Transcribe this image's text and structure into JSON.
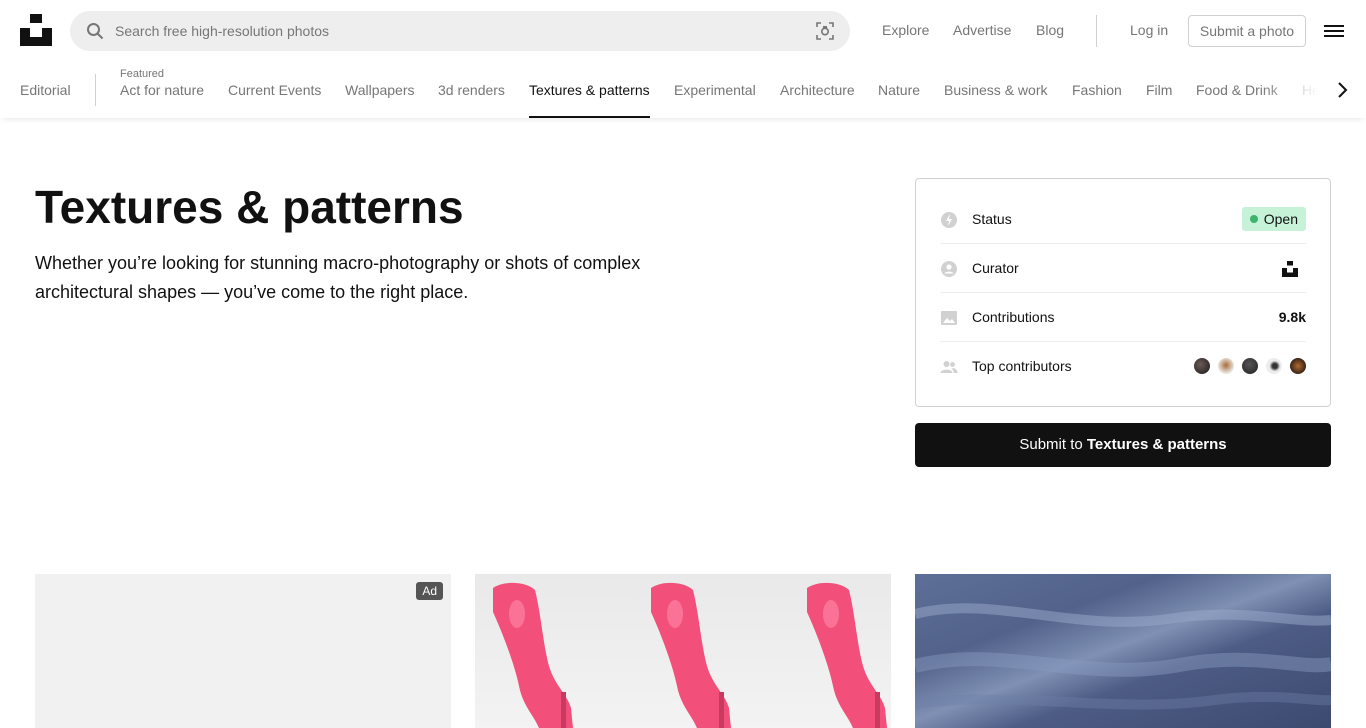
{
  "header": {
    "search_placeholder": "Search free high-resolution photos",
    "nav": {
      "explore": "Explore",
      "advertise": "Advertise",
      "blog": "Blog",
      "login": "Log in",
      "submit_photo": "Submit a photo"
    }
  },
  "topics": {
    "editorial": "Editorial",
    "featured_label": "Featured",
    "items": [
      "Act for nature",
      "Current Events",
      "Wallpapers",
      "3d renders",
      "Textures & patterns",
      "Experimental",
      "Architecture",
      "Nature",
      "Business & work",
      "Fashion",
      "Film",
      "Food & Drink",
      "He"
    ],
    "active_index": 4
  },
  "hero": {
    "title": "Textures & patterns",
    "description": "Whether you’re looking for stunning macro-photography or shots of complex architectural shapes — you’ve come to the right place."
  },
  "card": {
    "status_label": "Status",
    "status_value": "Open",
    "curator_label": "Curator",
    "contributions_label": "Contributions",
    "contributions_value": "9.8k",
    "top_contributors_label": "Top contributors",
    "submit_prefix": "Submit to ",
    "submit_topic": "Textures & patterns"
  },
  "grid": {
    "ad_label": "Ad"
  },
  "icons": {
    "search": "search-icon",
    "visual_search": "visual-search-icon",
    "menu": "hamburger-menu-icon",
    "next": "chevron-right-icon",
    "status": "bolt-icon",
    "curator": "person-icon",
    "contributions": "image-icon",
    "contributors": "people-icon"
  },
  "colors": {
    "accent": "#111111",
    "status_open_bg": "#c6f2d8",
    "status_open_dot": "#3cb46e",
    "muted": "#767676"
  }
}
